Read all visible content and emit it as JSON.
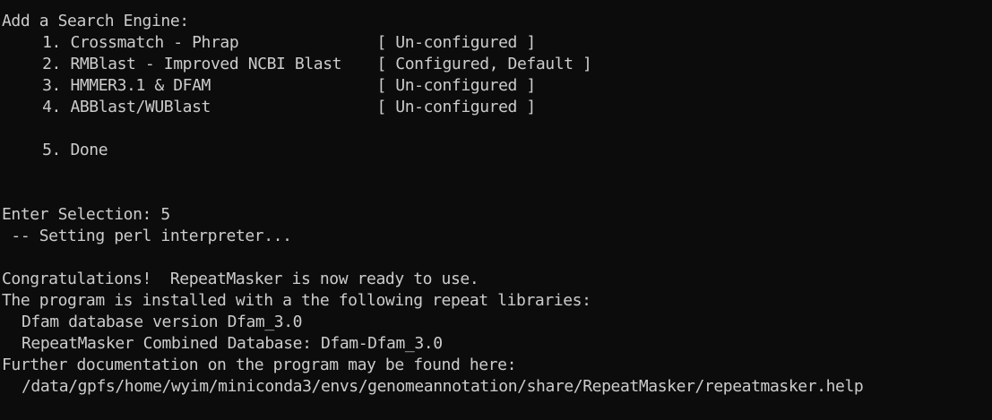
{
  "terminal": {
    "menu_title": "Add a Search Engine:",
    "menu_items": [
      {
        "num": "1.",
        "name": "Crossmatch - Phrap",
        "status": "[ Un-configured ]"
      },
      {
        "num": "2.",
        "name": "RMBlast - Improved NCBI Blast",
        "status": "[ Configured, Default ]"
      },
      {
        "num": "3.",
        "name": "HMMER3.1 & DFAM",
        "status": "[ Un-configured ]"
      },
      {
        "num": "4.",
        "name": "ABBlast/WUBlast",
        "status": "[ Un-configured ]"
      }
    ],
    "done_item": {
      "num": "5.",
      "name": "Done"
    },
    "prompt": "Enter Selection: 5",
    "setting_perl": " -- Setting perl interpreter...",
    "congrats": "Congratulations!  RepeatMasker is now ready to use.",
    "installed_with": "The program is installed with a the following repeat libraries:",
    "lib_dfam": "Dfam database version Dfam_3.0",
    "lib_combined": "RepeatMasker Combined Database: Dfam-Dfam_3.0",
    "further_doc": "Further documentation on the program may be found here:",
    "doc_path": "/data/gpfs/home/wyim/miniconda3/envs/genomeannotation/share/RepeatMasker/repeatmasker.help"
  }
}
